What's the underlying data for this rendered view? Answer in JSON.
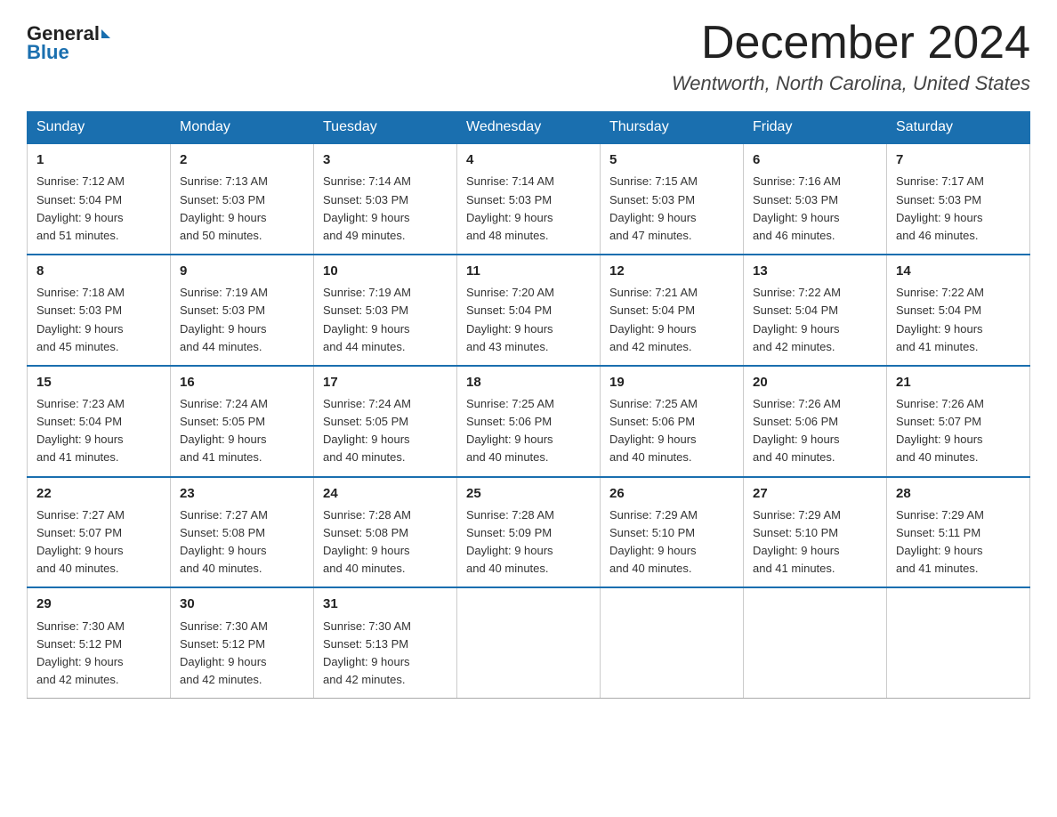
{
  "header": {
    "logo_general": "General",
    "logo_blue": "Blue",
    "month_title": "December 2024",
    "location": "Wentworth, North Carolina, United States"
  },
  "days_of_week": [
    "Sunday",
    "Monday",
    "Tuesday",
    "Wednesday",
    "Thursday",
    "Friday",
    "Saturday"
  ],
  "weeks": [
    [
      {
        "day": "1",
        "sunrise": "7:12 AM",
        "sunset": "5:04 PM",
        "daylight": "9 hours and 51 minutes."
      },
      {
        "day": "2",
        "sunrise": "7:13 AM",
        "sunset": "5:03 PM",
        "daylight": "9 hours and 50 minutes."
      },
      {
        "day": "3",
        "sunrise": "7:14 AM",
        "sunset": "5:03 PM",
        "daylight": "9 hours and 49 minutes."
      },
      {
        "day": "4",
        "sunrise": "7:14 AM",
        "sunset": "5:03 PM",
        "daylight": "9 hours and 48 minutes."
      },
      {
        "day": "5",
        "sunrise": "7:15 AM",
        "sunset": "5:03 PM",
        "daylight": "9 hours and 47 minutes."
      },
      {
        "day": "6",
        "sunrise": "7:16 AM",
        "sunset": "5:03 PM",
        "daylight": "9 hours and 46 minutes."
      },
      {
        "day": "7",
        "sunrise": "7:17 AM",
        "sunset": "5:03 PM",
        "daylight": "9 hours and 46 minutes."
      }
    ],
    [
      {
        "day": "8",
        "sunrise": "7:18 AM",
        "sunset": "5:03 PM",
        "daylight": "9 hours and 45 minutes."
      },
      {
        "day": "9",
        "sunrise": "7:19 AM",
        "sunset": "5:03 PM",
        "daylight": "9 hours and 44 minutes."
      },
      {
        "day": "10",
        "sunrise": "7:19 AM",
        "sunset": "5:03 PM",
        "daylight": "9 hours and 44 minutes."
      },
      {
        "day": "11",
        "sunrise": "7:20 AM",
        "sunset": "5:04 PM",
        "daylight": "9 hours and 43 minutes."
      },
      {
        "day": "12",
        "sunrise": "7:21 AM",
        "sunset": "5:04 PM",
        "daylight": "9 hours and 42 minutes."
      },
      {
        "day": "13",
        "sunrise": "7:22 AM",
        "sunset": "5:04 PM",
        "daylight": "9 hours and 42 minutes."
      },
      {
        "day": "14",
        "sunrise": "7:22 AM",
        "sunset": "5:04 PM",
        "daylight": "9 hours and 41 minutes."
      }
    ],
    [
      {
        "day": "15",
        "sunrise": "7:23 AM",
        "sunset": "5:04 PM",
        "daylight": "9 hours and 41 minutes."
      },
      {
        "day": "16",
        "sunrise": "7:24 AM",
        "sunset": "5:05 PM",
        "daylight": "9 hours and 41 minutes."
      },
      {
        "day": "17",
        "sunrise": "7:24 AM",
        "sunset": "5:05 PM",
        "daylight": "9 hours and 40 minutes."
      },
      {
        "day": "18",
        "sunrise": "7:25 AM",
        "sunset": "5:06 PM",
        "daylight": "9 hours and 40 minutes."
      },
      {
        "day": "19",
        "sunrise": "7:25 AM",
        "sunset": "5:06 PM",
        "daylight": "9 hours and 40 minutes."
      },
      {
        "day": "20",
        "sunrise": "7:26 AM",
        "sunset": "5:06 PM",
        "daylight": "9 hours and 40 minutes."
      },
      {
        "day": "21",
        "sunrise": "7:26 AM",
        "sunset": "5:07 PM",
        "daylight": "9 hours and 40 minutes."
      }
    ],
    [
      {
        "day": "22",
        "sunrise": "7:27 AM",
        "sunset": "5:07 PM",
        "daylight": "9 hours and 40 minutes."
      },
      {
        "day": "23",
        "sunrise": "7:27 AM",
        "sunset": "5:08 PM",
        "daylight": "9 hours and 40 minutes."
      },
      {
        "day": "24",
        "sunrise": "7:28 AM",
        "sunset": "5:08 PM",
        "daylight": "9 hours and 40 minutes."
      },
      {
        "day": "25",
        "sunrise": "7:28 AM",
        "sunset": "5:09 PM",
        "daylight": "9 hours and 40 minutes."
      },
      {
        "day": "26",
        "sunrise": "7:29 AM",
        "sunset": "5:10 PM",
        "daylight": "9 hours and 40 minutes."
      },
      {
        "day": "27",
        "sunrise": "7:29 AM",
        "sunset": "5:10 PM",
        "daylight": "9 hours and 41 minutes."
      },
      {
        "day": "28",
        "sunrise": "7:29 AM",
        "sunset": "5:11 PM",
        "daylight": "9 hours and 41 minutes."
      }
    ],
    [
      {
        "day": "29",
        "sunrise": "7:30 AM",
        "sunset": "5:12 PM",
        "daylight": "9 hours and 42 minutes."
      },
      {
        "day": "30",
        "sunrise": "7:30 AM",
        "sunset": "5:12 PM",
        "daylight": "9 hours and 42 minutes."
      },
      {
        "day": "31",
        "sunrise": "7:30 AM",
        "sunset": "5:13 PM",
        "daylight": "9 hours and 42 minutes."
      },
      null,
      null,
      null,
      null
    ]
  ],
  "labels": {
    "sunrise": "Sunrise:",
    "sunset": "Sunset:",
    "daylight": "Daylight:"
  }
}
